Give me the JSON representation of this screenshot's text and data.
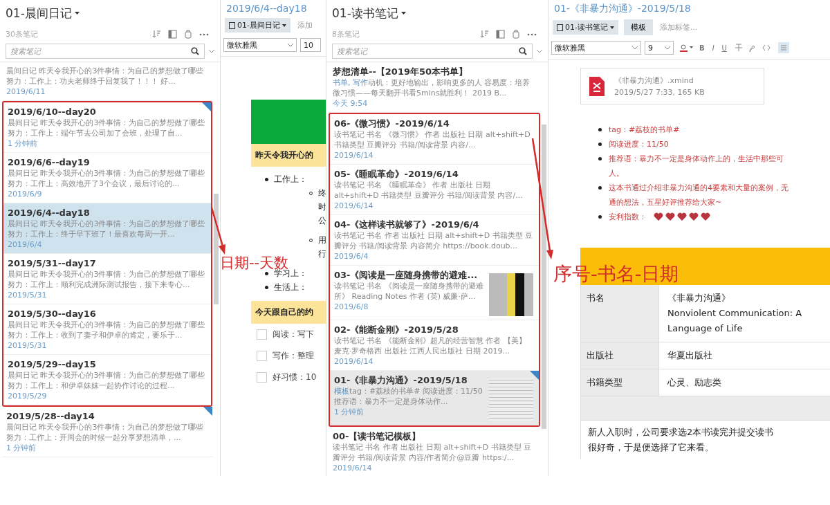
{
  "list1": {
    "title": "01-晨间日记",
    "count": "30条笔记",
    "search": {
      "placeholder": "搜索笔记"
    },
    "notes": [
      {
        "snippet": "晨间日记 昨天令我开心的3件事情：为自己的梦想做了哪些努力：工作上：功夫老师终于回复我了！！！ 好...",
        "date": "2019/6/11",
        "selected": false,
        "flagged": false
      },
      {
        "title": "2019/6/10--day20",
        "snippet": "晨间日记 昨天令我开心的3件事情：为自己的梦想做了哪些努力：工作上：端午节去公司加了会班，处理了自...",
        "date": "1 分钟前",
        "selected": false,
        "flagged": true
      },
      {
        "title": "2019/6/6--day19",
        "snippet": "晨间日记 昨天令我开心的3件事情：为自己的梦想做了哪些努力：工作上：高效地开了3个会议，最后讨论的...",
        "date": "2019/6/9",
        "selected": false,
        "flagged": false
      },
      {
        "title": "2019/6/4--day18",
        "snippet": "晨间日记 昨天令我开心的3件事情：为自己的梦想做了哪些努力：工作上：终于早下班了！最喜欢每周一开...",
        "date": "2019/6/4",
        "selected": true,
        "flagged": false
      },
      {
        "title": "2019/5/31--day17",
        "snippet": "晨间日记 昨天令我开心的3件事情：为自己的梦想做了哪些努力：工作上：顺利完成洲际测试报告，接下来专心...",
        "date": "2019/5/31",
        "selected": false,
        "flagged": false
      },
      {
        "title": "2019/5/30--day16",
        "snippet": "晨间日记 昨天令我开心的3件事情：为自己的梦想做了哪些努力：工作上：收到了妻子和伊卓的肯定，要乐于...",
        "date": "2019/5/31",
        "selected": false,
        "flagged": false
      },
      {
        "title": "2019/5/29--day15",
        "snippet": "晨间日记 昨天令我开心的3件事情：为自己的梦想做了哪些努力：工作上：和伊卓妹妹一起协作讨论的过程...",
        "date": "2019/5/29",
        "selected": false,
        "flagged": false
      },
      {
        "title": "2019/5/28--day14",
        "snippet": "晨间日记 昨天令我开心的3件事情：为自己的梦想做了哪些努力：工作上：开周会的时候一起分享梦想清单，...",
        "date": "1 分钟前",
        "selected": false,
        "flagged": true
      }
    ]
  },
  "editor1": {
    "title": "2019/6/4--day18",
    "notebook": "01-晨间日记",
    "tag_field": {
      "placeholder": "添加"
    },
    "font": "微软雅黑",
    "size": "10",
    "heading1": "昨天令我开心的",
    "bullets": [
      {
        "text": "工作上：",
        "children": [
          {
            "text": "终时公"
          },
          {
            "text": "用行"
          }
        ]
      },
      {
        "text": "学习上："
      },
      {
        "text": "生活上："
      }
    ],
    "heading2": "今天跟自己的约",
    "tasks": [
      {
        "text": "阅读：写下",
        "checked": false
      },
      {
        "text": "写作：整理",
        "checked": false
      },
      {
        "text": "好习惯：10",
        "checked": false
      }
    ]
  },
  "list2": {
    "title": "01-读书笔记",
    "count": "8条笔记",
    "search": {
      "placeholder": "搜索笔记"
    },
    "notes": [
      {
        "title": "梦想清单--【2019年50本书单】",
        "tags": "书单, 写作",
        "snippet": "动机：更好地输出，影响更多的人 容易度：培养微习惯——每天翻开书看5mins就胜利！ 2019 B...",
        "date": "今天 9:54",
        "selected": false,
        "flagged": false,
        "thumbnail": false
      },
      {
        "title": "06-《微习惯》-2019/6/14",
        "snippet": "读书笔记 书名 《微习惯》 作者 出版社 日期 alt+shift+D 书籍类型 豆瓣评分 书籍/阅读背景 内容/...",
        "date": "2019/6/14",
        "selected": false,
        "flagged": false,
        "thumbnail": false
      },
      {
        "title": "05-《睡眠革命》-2019/6/14",
        "snippet": "读书笔记 书名 《睡眠革命》 作者 出版社 日期 alt+shift+D 书籍类型 豆瓣评分 书籍/阅读背景 内容/...",
        "date": "2019/6/14",
        "selected": false,
        "flagged": false,
        "thumbnail": false
      },
      {
        "title": "04-《这样读书就够了》-2019/6/4",
        "snippet": "读书笔记 书名 作者 出版社 日期 alt+shift+D 书籍类型 豆瓣评分 书籍/阅读背景 内容简介 https://book.doub...",
        "date": "2019/6/4",
        "selected": false,
        "flagged": false,
        "thumbnail": false
      },
      {
        "title": "03-《阅读是一座随身携带的避难...",
        "snippet": "读书笔记 书名 《阅读是一座随身携带的避难所》 Reading Notes 作者 (英) 威廉·萨...",
        "date": "2019/6/8",
        "selected": false,
        "flagged": false,
        "thumbnail": true
      },
      {
        "title": "02-《能断金刚》-2019/5/28",
        "snippet": "读书笔记 书名 《能断金刚》超凡的经营智慧 作者 【美】麦克·罗奇格西 出版社 江西人民出版社 日期 2019...",
        "date": "2019/6/14",
        "selected": false,
        "flagged": false,
        "thumbnail": false
      },
      {
        "title": "01-《非暴力沟通》-2019/5/18",
        "tags": "模板",
        "snippet": "tag：#荔枝的书单# 阅读进度：11/50 推荐语：暴力不一定是身体动作...",
        "date": "1 分钟前",
        "selected": true,
        "flagged": true,
        "thumbnail": true
      },
      {
        "title": "00-【读书笔记模板】",
        "snippet": "读书笔记 书名 作者 出版社 日期 alt+shift+D 书籍类型 豆瓣评分 书籍/阅读背景 内容/作者简介@豆瓣 https:/...",
        "date": "2019/6/14",
        "selected": false,
        "flagged": false,
        "thumbnail": false
      }
    ]
  },
  "editor2": {
    "title": "01-《非暴力沟通》-2019/5/18",
    "notebook": "01-读书笔记",
    "template_button": "模板",
    "tag_field": {
      "placeholder": "添加标签..."
    },
    "font": "微软雅黑",
    "size": "9",
    "format_buttons": [
      "B",
      "I",
      "U"
    ],
    "attachment": {
      "name": "《非暴力沟通》.xmind",
      "meta": "2019/5/27 7:33, 165 KB"
    },
    "bullets": [
      {
        "kind": "text",
        "lines": [
          "tag：#荔枝的书单#"
        ]
      },
      {
        "kind": "text",
        "lines": [
          "阅读进度：11/50"
        ]
      },
      {
        "kind": "text",
        "lines": [
          "推荐语：暴力不一定是身体动作上的，生活中那些可",
          "人。"
        ]
      },
      {
        "kind": "text",
        "lines": [
          "这本书通过介绍非暴力沟通的4要素和大量的案例，无",
          "通的想法，五星好评推荐给大家~"
        ]
      },
      {
        "kind": "rating",
        "label": "安利指数：",
        "stars": 5
      }
    ],
    "table": [
      {
        "label": "书名",
        "lines": [
          "《非暴力沟通》",
          "Nonviolent Communication: A",
          "Language of Life"
        ]
      },
      {
        "label": "出版社",
        "lines": [
          "华夏出版社"
        ]
      },
      {
        "label": "书籍类型",
        "lines": [
          "心灵、励志类"
        ]
      }
    ],
    "paragraph": [
      "新人入职时，公司要求选2本书读完并提交读书",
      "很好奇，于是便选择了它来看。"
    ]
  },
  "annotations": [
    {
      "text": "日期--天数"
    },
    {
      "text": "序号-书名-日期"
    }
  ]
}
